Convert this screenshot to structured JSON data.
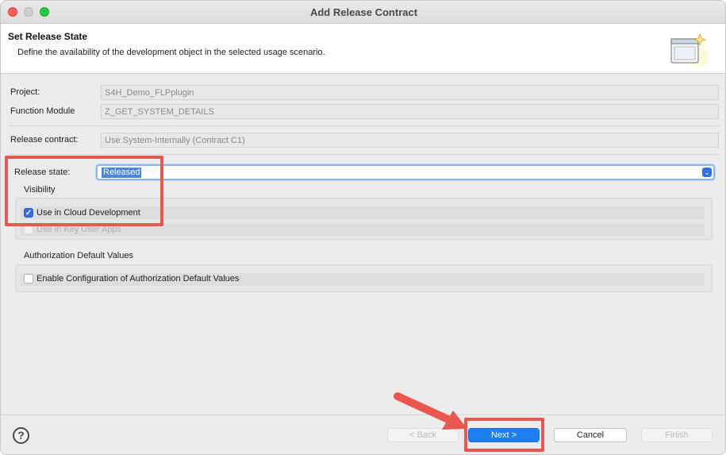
{
  "window": {
    "title": "Add Release Contract"
  },
  "banner": {
    "title": "Set Release State",
    "description": "Define the availability of the development object in the selected usage scenario."
  },
  "form": {
    "project_label": "Project:",
    "project_value": "S4H_Demo_FLPplugin",
    "function_module_label": "Function Module",
    "function_module_value": "Z_GET_SYSTEM_DETAILS",
    "release_contract_label": "Release contract:",
    "release_contract_value": "Use System-Internally (Contract C1)",
    "release_state_label": "Release state:",
    "release_state_value": "Released"
  },
  "visibility": {
    "label": "Visibility",
    "use_in_cloud_dev": {
      "label": "Use in Cloud Development",
      "checked": true
    },
    "use_in_key_user_apps": {
      "label": "Use in Key User Apps",
      "checked": false,
      "enabled": false
    }
  },
  "authorization": {
    "label": "Authorization Default Values",
    "enable_config": {
      "label": "Enable Configuration of Authorization Default Values",
      "checked": false
    }
  },
  "footer": {
    "help_symbol": "?",
    "back_label": "< Back",
    "next_label": "Next >",
    "cancel_label": "Cancel",
    "finish_label": "Finish"
  },
  "colors": {
    "accent": "#1d7ef2",
    "highlight": "#e9574f"
  }
}
